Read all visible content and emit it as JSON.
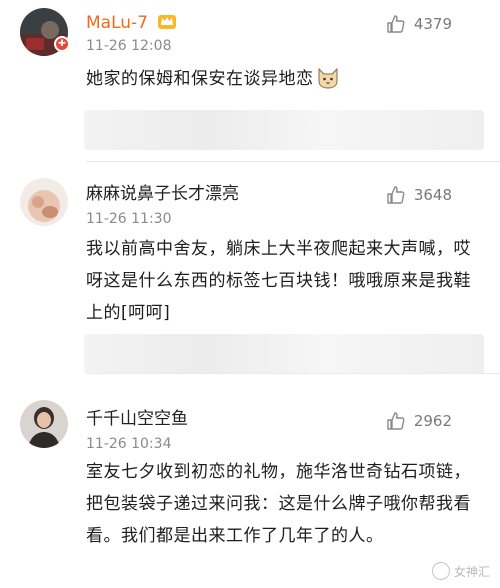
{
  "comments": [
    {
      "username": "MaLu-7",
      "time": "11-26 12:08",
      "likes": "4379",
      "text": "她家的保姆和保安在谈异地恋",
      "has_vip_crown": true,
      "emoji": "cat-face-emoji"
    },
    {
      "username": "麻麻说鼻子长才漂亮",
      "time": "11-26 11:30",
      "likes": "3648",
      "text": "我以前高中舍友，躺床上大半夜爬起来大声喊，哎呀这是什么东西的标签七百块钱！哦哦原来是我鞋上的[呵呵]"
    },
    {
      "username": "千千山空空鱼",
      "time": "11-26 10:34",
      "likes": "2962",
      "text": "室友七夕收到初恋的礼物，施华洛世奇钻石项链，把包装袋子递过来问我：这是什么牌子哦你帮我看看。我们都是出来工作了几年了的人。"
    }
  ],
  "watermark": "女神汇",
  "colors": {
    "vip_name": "#f36a1e",
    "badge": "#e8483b",
    "meta": "#8b8b8b"
  }
}
